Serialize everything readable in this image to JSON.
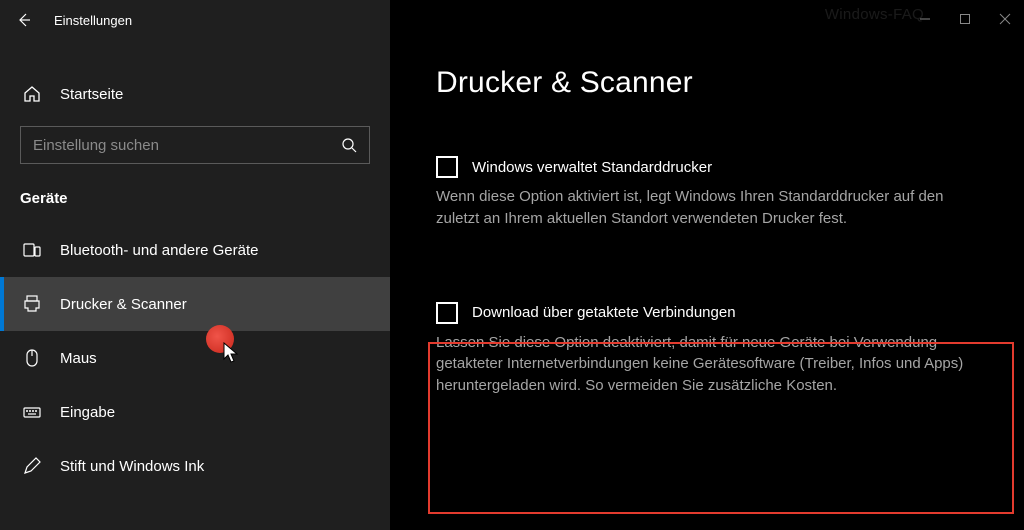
{
  "titlebar": {
    "title": "Einstellungen"
  },
  "sidebar": {
    "home_label": "Startseite",
    "search_placeholder": "Einstellung suchen",
    "section_header": "Geräte",
    "items": [
      {
        "label": "Bluetooth- und andere Geräte"
      },
      {
        "label": "Drucker & Scanner"
      },
      {
        "label": "Maus"
      },
      {
        "label": "Eingabe"
      },
      {
        "label": "Stift und Windows Ink"
      }
    ]
  },
  "main": {
    "page_title": "Drucker & Scanner",
    "option1": {
      "label": "Windows verwaltet Standarddrucker",
      "desc": "Wenn diese Option aktiviert ist, legt Windows Ihren Standarddrucker auf den zuletzt an Ihrem aktuellen Standort verwendeten Drucker fest."
    },
    "option2": {
      "label": "Download über getaktete Verbindungen",
      "desc": "Lassen Sie diese Option deaktiviert, damit für neue Geräte bei Verwendung getakteter Internetverbindungen keine Gerätesoftware (Treiber, Infos und Apps) heruntergeladen wird. So vermeiden Sie zusätzliche Kosten."
    }
  },
  "watermark": "Windows-FAQ"
}
